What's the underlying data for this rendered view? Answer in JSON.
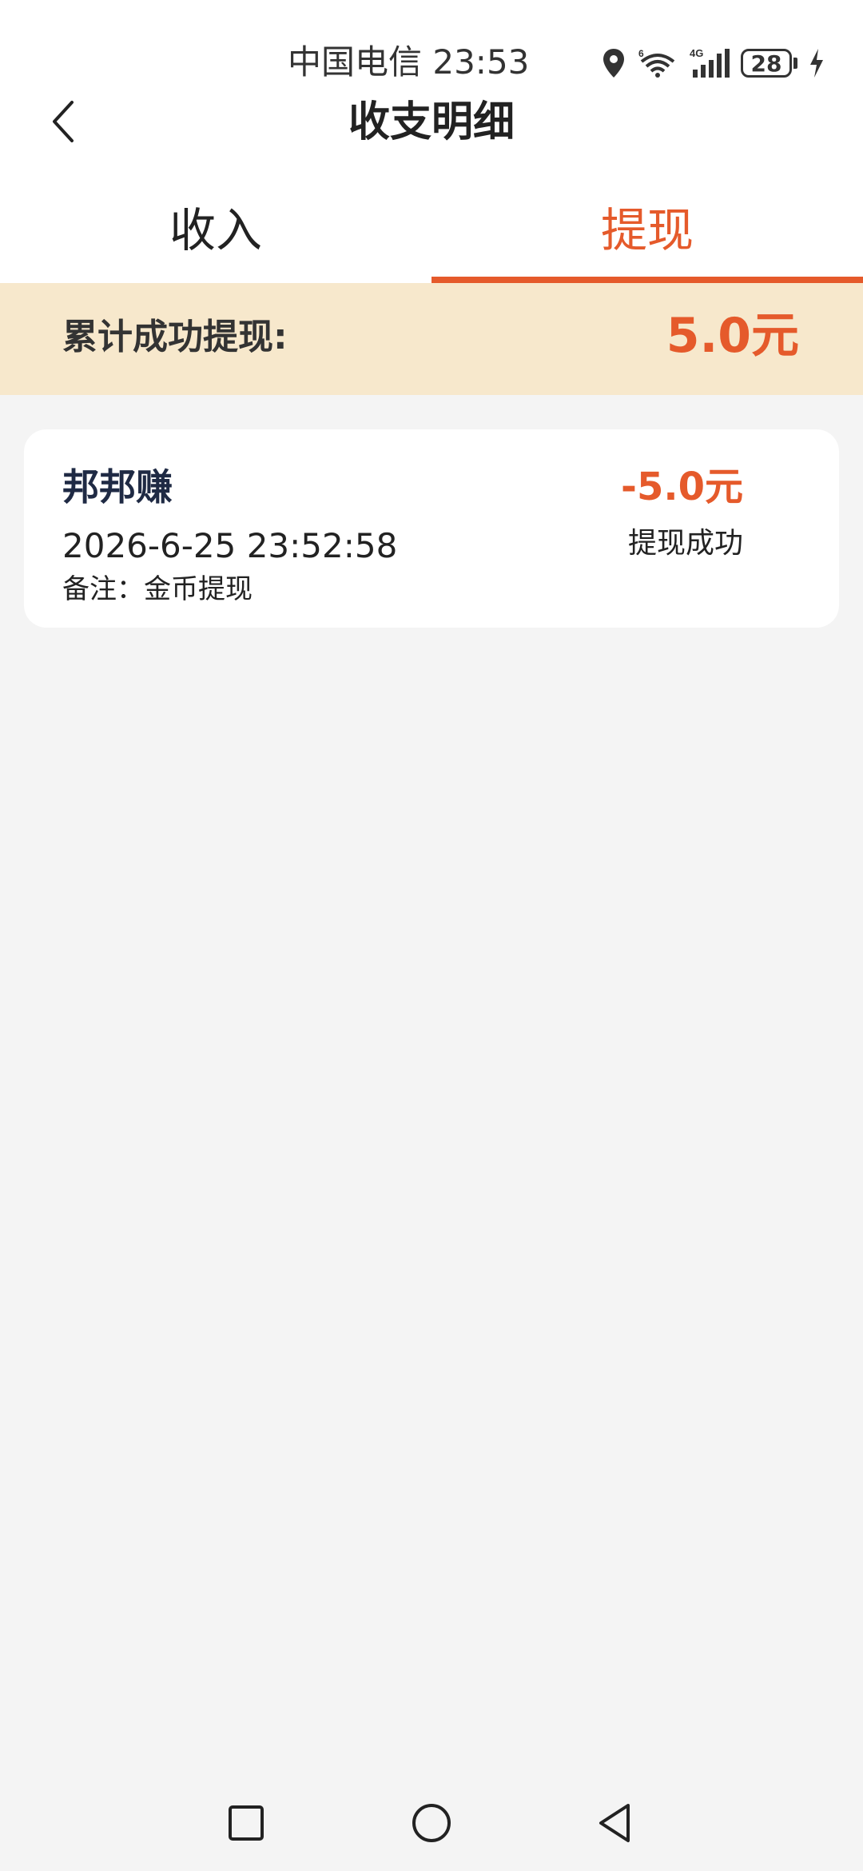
{
  "status_bar": {
    "carrier_time": "中国电信 23:53",
    "battery": "28",
    "icons": [
      "location-icon",
      "wifi-icon",
      "signal-4g-icon",
      "battery-icon",
      "charging-icon"
    ]
  },
  "header": {
    "title": "收支明细",
    "back_icon": "chevron-left-icon"
  },
  "tabs": [
    {
      "label": "收入",
      "active": false
    },
    {
      "label": "提现",
      "active": true
    }
  ],
  "summary": {
    "label": "累计成功提现:",
    "value": "5.0元"
  },
  "records": [
    {
      "name": "邦邦赚",
      "time": "2026-6-25 23:52:58",
      "note": "备注：金币提现",
      "amount": "-5.0元",
      "status": "提现成功"
    }
  ],
  "nav_bar": {
    "icons": [
      "square-recent-icon",
      "circle-home-icon",
      "triangle-back-icon"
    ]
  },
  "colors": {
    "accent": "#e55a2b",
    "summary_bg": "#f7e8cc",
    "page_bg": "#f4f4f4"
  }
}
